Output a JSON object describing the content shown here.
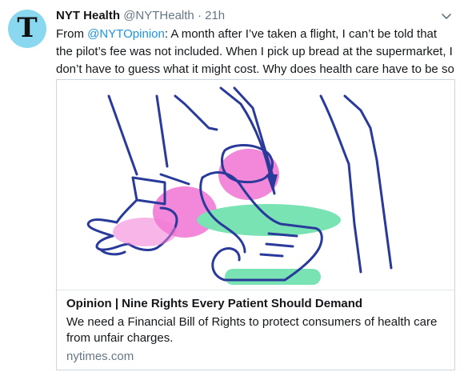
{
  "tweet": {
    "author_name": "NYT Health",
    "handle": "@NYTHealth",
    "separator": "·",
    "time": "21h",
    "avatar_letter": "T",
    "text_before": "From ",
    "mention": "@NYTOpinion",
    "text_after": ": A month after I’ve taken a flight, I can’t be told that the pilot’s fee was not included. When I pick up bread at the supermarket, I don’t have to guess what it might cost. Why does health care have to be so different?"
  },
  "card": {
    "title": "Opinion | Nine Rights Every Patient Should Demand",
    "description": "We need a Financial Bill of Rights to protect consumers of health care from unfair charges.",
    "domain": "nytimes.com",
    "image_icon": "illustration-hands-receipt"
  },
  "colors": {
    "link": "#1b95e0",
    "muted": "#657786",
    "avatar_bg": "#8ad8ef",
    "ink_blue": "#2a3a9a",
    "pink": "#f27ad6",
    "mint": "#79e3b4"
  }
}
